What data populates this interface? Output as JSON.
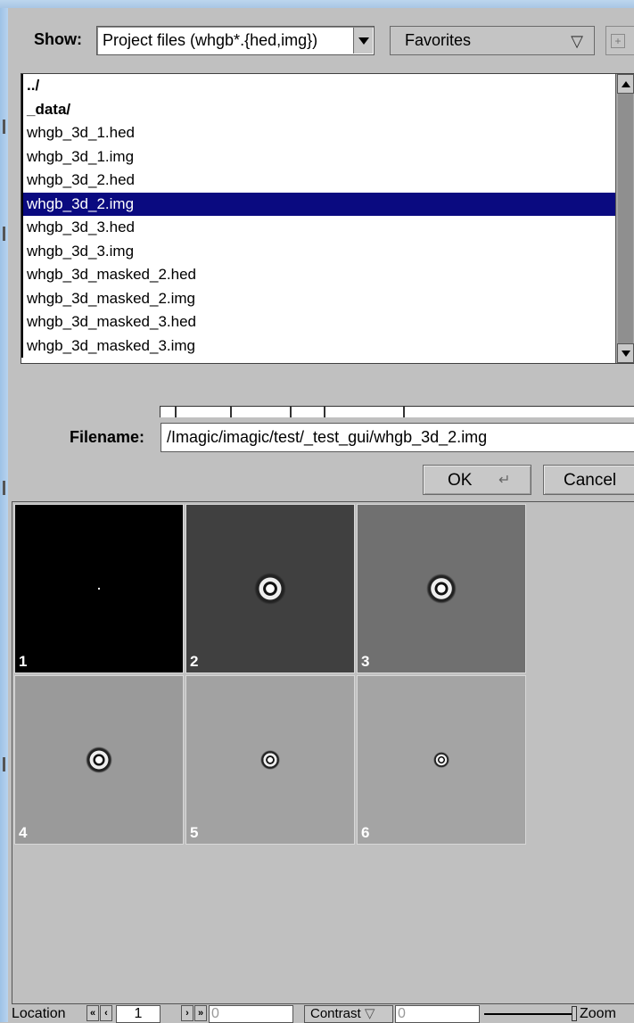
{
  "dialog": {
    "show_label": "Show:",
    "filter_value": "Project files (whgb*.{hed,img})",
    "favorites_label": "Favorites",
    "filename_label": "Filename:",
    "filename_value": "/Imagic/imagic/test/_test_gui/whgb_3d_2.img",
    "ok_label": "OK",
    "cancel_label": "Cancel"
  },
  "files": [
    {
      "name": "../",
      "type": "dir"
    },
    {
      "name": "_data/",
      "type": "dir"
    },
    {
      "name": "whgb_3d_1.hed",
      "type": "file"
    },
    {
      "name": "whgb_3d_1.img",
      "type": "file"
    },
    {
      "name": "whgb_3d_2.hed",
      "type": "file"
    },
    {
      "name": "whgb_3d_2.img",
      "type": "file",
      "selected": true
    },
    {
      "name": "whgb_3d_3.hed",
      "type": "file"
    },
    {
      "name": "whgb_3d_3.img",
      "type": "file"
    },
    {
      "name": "whgb_3d_masked_2.hed",
      "type": "file"
    },
    {
      "name": "whgb_3d_masked_2.img",
      "type": "file"
    },
    {
      "name": "whgb_3d_masked_3.hed",
      "type": "file"
    },
    {
      "name": "whgb_3d_masked_3.img",
      "type": "file"
    }
  ],
  "colors": {
    "selection": "#0a0a80",
    "panel": "#c0c0c0"
  },
  "images": [
    {
      "label": "1",
      "background": "#000000"
    },
    {
      "label": "2",
      "background": "#404040"
    },
    {
      "label": "3",
      "background": "#707070"
    },
    {
      "label": "4",
      "background": "#9a9a9a"
    },
    {
      "label": "5",
      "background": "#a2a2a2"
    },
    {
      "label": "6",
      "background": "#a4a4a4"
    }
  ],
  "statusbar": {
    "location_label": "Location",
    "current_index": "1",
    "total_value": "0",
    "contrast_label": "Contrast",
    "contrast_value": "0",
    "zoom_label": "Zoom"
  }
}
